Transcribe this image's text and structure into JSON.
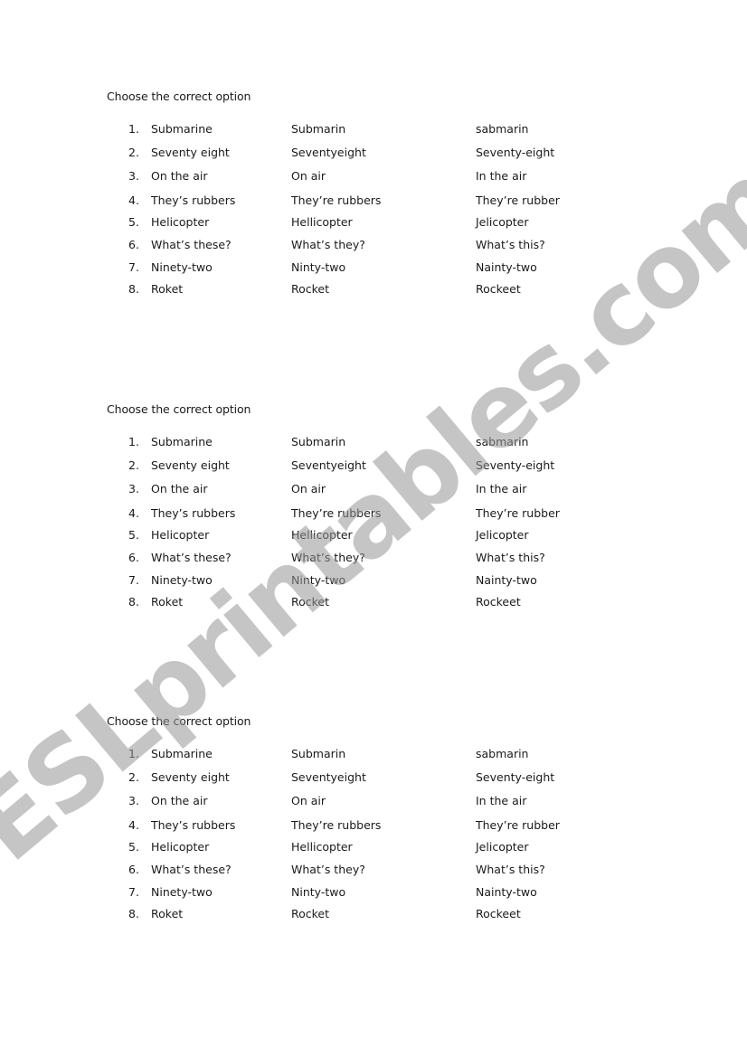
{
  "watermark": "ESLprintables.com",
  "exercises": [
    {
      "heading": "Choose the correct option",
      "items": [
        {
          "number": "1.",
          "options": [
            "Submarine",
            "Submarin",
            "sabmarin"
          ]
        },
        {
          "number": "2.",
          "options": [
            "Seventy eight",
            "Seventyeight",
            "Seventy-eight"
          ]
        },
        {
          "number": "3.",
          "options": [
            "On the air",
            "On air",
            "In the air"
          ]
        },
        {
          "number": "4.",
          "options": [
            "They’s rubbers",
            "They’re rubbers",
            "They’re rubber"
          ]
        },
        {
          "number": "5.",
          "options": [
            "Helicopter",
            "Hellicopter",
            "Jelicopter"
          ]
        },
        {
          "number": "6.",
          "options": [
            "What’s these?",
            "What’s they?",
            "What’s this?"
          ]
        },
        {
          "number": "7.",
          "options": [
            "Ninety-two",
            "Ninty-two",
            "Nainty-two"
          ]
        },
        {
          "number": "8.",
          "options": [
            "Roket",
            "Rocket",
            "Rockeet"
          ]
        }
      ]
    },
    {
      "heading": "Choose the correct option",
      "items": [
        {
          "number": "1.",
          "options": [
            "Submarine",
            "Submarin",
            "sabmarin"
          ]
        },
        {
          "number": "2.",
          "options": [
            "Seventy eight",
            "Seventyeight",
            "Seventy-eight"
          ]
        },
        {
          "number": "3.",
          "options": [
            "On the air",
            "On air",
            "In the air"
          ]
        },
        {
          "number": "4.",
          "options": [
            "They’s rubbers",
            "They’re rubbers",
            "They’re rubber"
          ]
        },
        {
          "number": "5.",
          "options": [
            "Helicopter",
            "Hellicopter",
            "Jelicopter"
          ]
        },
        {
          "number": "6.",
          "options": [
            "What’s these?",
            "What’s they?",
            "What’s this?"
          ]
        },
        {
          "number": "7.",
          "options": [
            "Ninety-two",
            "Ninty-two",
            "Nainty-two"
          ]
        },
        {
          "number": "8.",
          "options": [
            "Roket",
            "Rocket",
            "Rockeet"
          ]
        }
      ]
    },
    {
      "heading": "Choose the correct option",
      "items": [
        {
          "number": "1.",
          "options": [
            "Submarine",
            "Submarin",
            "sabmarin"
          ]
        },
        {
          "number": "2.",
          "options": [
            "Seventy eight",
            "Seventyeight",
            "Seventy-eight"
          ]
        },
        {
          "number": "3.",
          "options": [
            "On the air",
            "On air",
            "In the air"
          ]
        },
        {
          "number": "4.",
          "options": [
            "They’s rubbers",
            "They’re rubbers",
            "They’re rubber"
          ]
        },
        {
          "number": "5.",
          "options": [
            "Helicopter",
            "Hellicopter",
            "Jelicopter"
          ]
        },
        {
          "number": "6.",
          "options": [
            "What’s these?",
            "What’s they?",
            "What’s this?"
          ]
        },
        {
          "number": "7.",
          "options": [
            "Ninety-two",
            "Ninty-two",
            "Nainty-two"
          ]
        },
        {
          "number": "8.",
          "options": [
            "Roket",
            "Rocket",
            "Rockeet"
          ]
        }
      ]
    }
  ]
}
